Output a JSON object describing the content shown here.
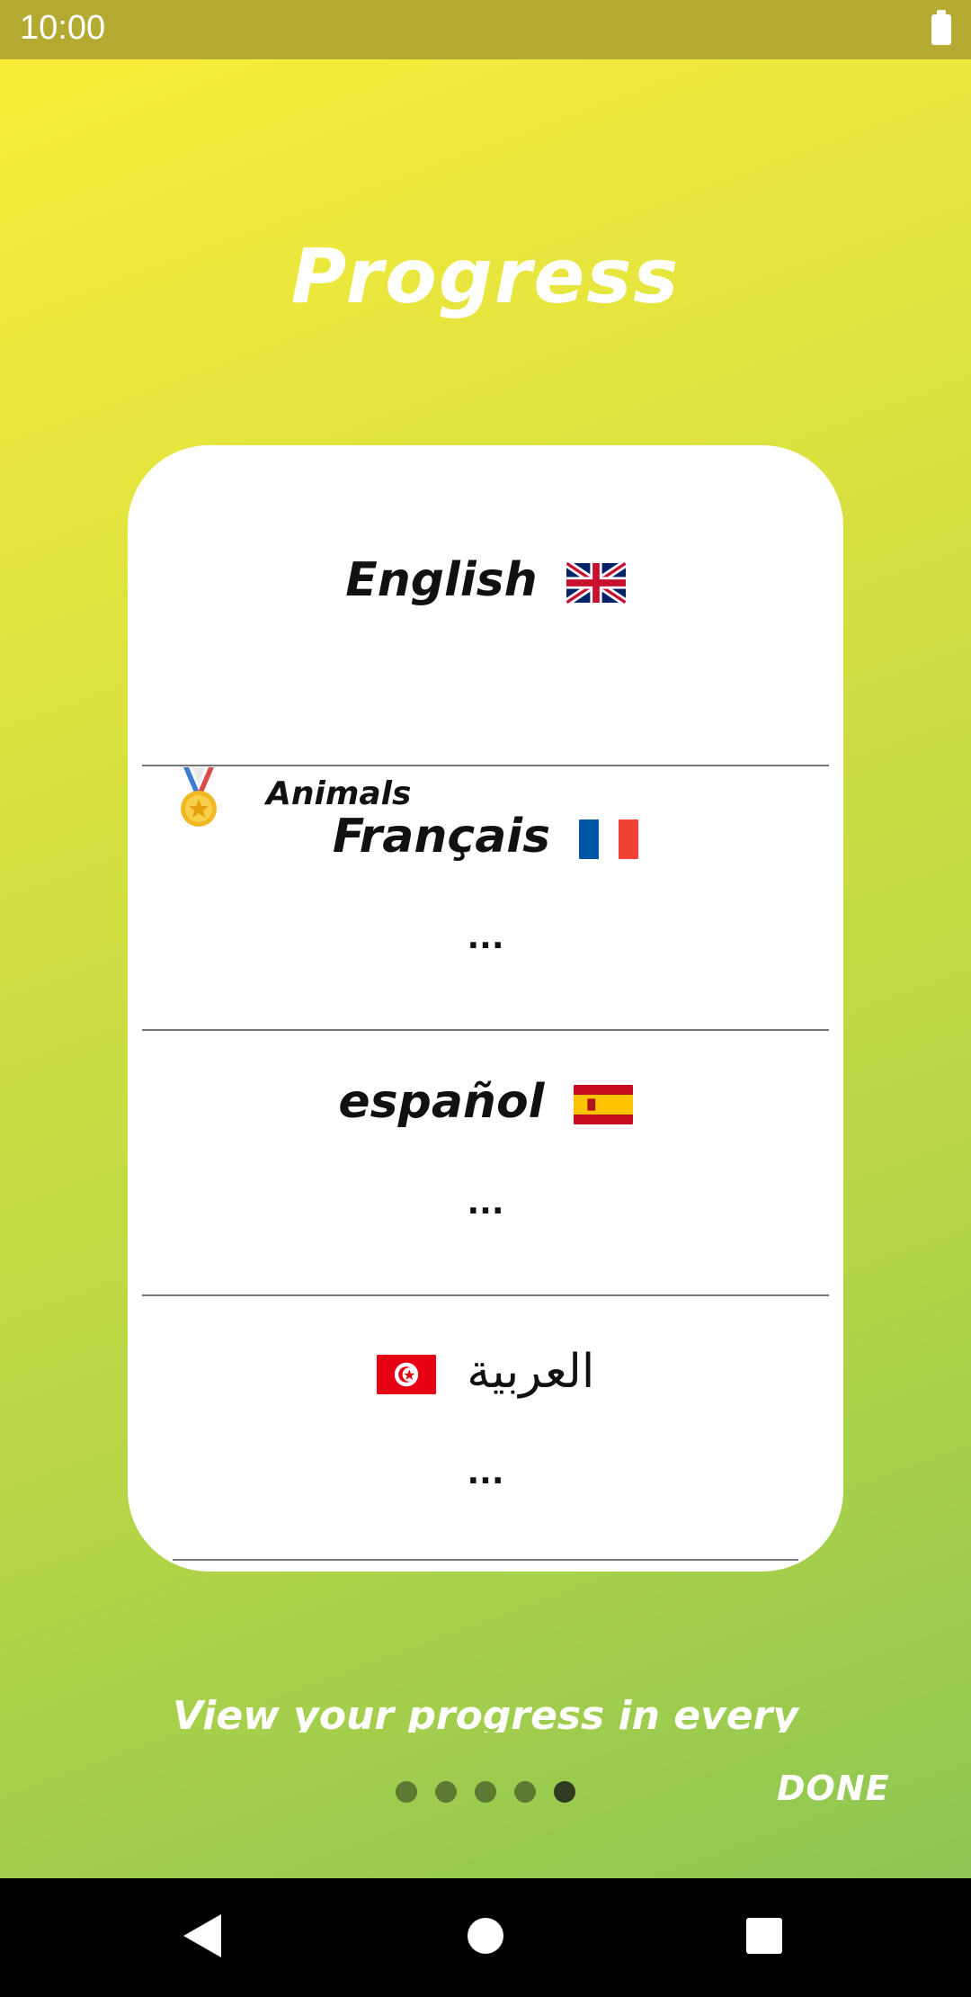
{
  "status_bar": {
    "time": "10:00",
    "battery_icon": "battery-full-icon"
  },
  "title": "Progress",
  "languages": [
    {
      "name": "English",
      "flag_icon": "flag-uk-icon",
      "items": [
        {
          "icon": "medal-icon",
          "label": "Animals"
        }
      ]
    },
    {
      "name": "Français",
      "flag_icon": "flag-france-icon",
      "ellipsis": "..."
    },
    {
      "name": "español",
      "flag_icon": "flag-spain-icon",
      "ellipsis": "..."
    },
    {
      "name": "العربية",
      "flag_icon": "flag-tunisia-icon",
      "ellipsis": "..."
    }
  ],
  "caption": "View your progress in every",
  "pager": {
    "count": 5,
    "active_index": 4
  },
  "done_label": "DONE",
  "colors": {
    "accent_dot": "#5d7a33",
    "active_dot": "#2f3b22",
    "status_bar": "#b4a931"
  },
  "nav": {
    "back_icon": "back-triangle-icon",
    "home_icon": "home-circle-icon",
    "recents_icon": "recents-square-icon"
  }
}
